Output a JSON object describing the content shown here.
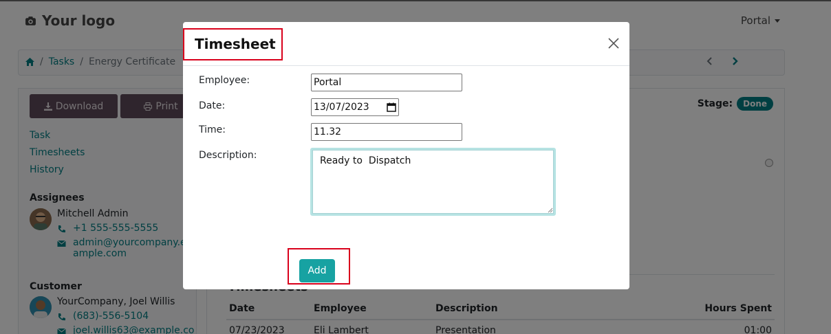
{
  "header": {
    "logo_text": "Your logo",
    "user_menu": "Portal"
  },
  "breadcrumb": {
    "home_icon": "home-icon",
    "items": [
      "Tasks",
      "Energy Certificate"
    ],
    "separator": "/"
  },
  "sidebar": {
    "download_label": "Download",
    "print_label": "Print",
    "links": [
      "Task",
      "Timesheets",
      "History"
    ],
    "assignees_heading": "Assignees",
    "assignee": {
      "name": "Mitchell Admin",
      "phone": "+1 555-555-5555",
      "email_line1": "admin@yourcompany.ex",
      "email_line2": "ample.com"
    },
    "customer_heading": "Customer",
    "customer": {
      "name": "YourCompany, Joel Willis",
      "phone": "(683)-556-5104",
      "email": "joel.willis63@example.co"
    }
  },
  "content": {
    "stage_label": "Stage:",
    "stage_value": "Done",
    "timesheets_heading": "Timesheets",
    "table": {
      "columns": [
        "Date",
        "Employee",
        "Description",
        "Hours Spent"
      ],
      "rows": [
        [
          "07/23/2023",
          "Eli Lambert",
          "Presentation",
          "01:00"
        ]
      ]
    }
  },
  "modal": {
    "title": "Timesheet",
    "close_icon": "close-icon",
    "fields": {
      "employee_label": "Employee:",
      "employee_value": "Portal",
      "date_label": "Date:",
      "date_value": "13/07/2023",
      "time_label": "Time:",
      "time_value": "11.32",
      "description_label": "Description:",
      "description_value": "Ready to  Dispatch"
    },
    "add_label": "Add"
  },
  "colors": {
    "accent": "#017e84",
    "add_button": "#17a2a2",
    "dark_button": "#5f4a5a",
    "highlight_box": "#d9001b"
  }
}
